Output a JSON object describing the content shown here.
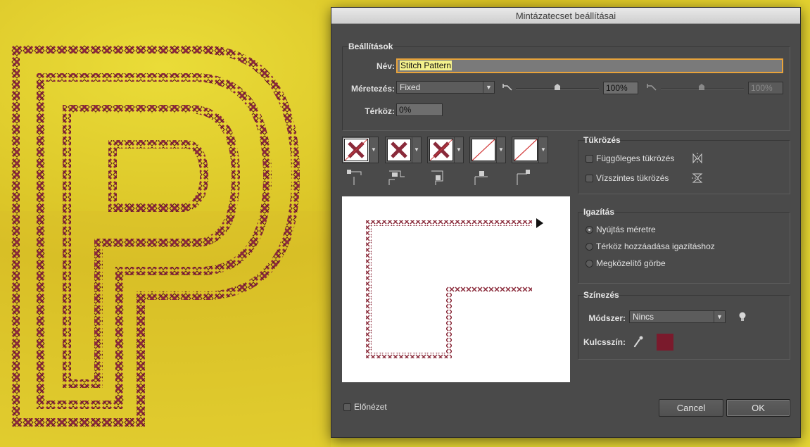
{
  "dialog": {
    "title": "Mintázatecset beállításai"
  },
  "settings": {
    "title": "Beállítások",
    "name_label": "Név:",
    "name_value": "Stitch Pattern",
    "scale_label": "Méretezés:",
    "scale_value": "Fixed",
    "scale_percent": "100%",
    "scale_percent_max": "100%",
    "spacing_label": "Térköz:",
    "spacing_value": "0%"
  },
  "tiles": [
    {
      "name": "side-tile",
      "selected": true
    },
    {
      "name": "outer-corner-tile"
    },
    {
      "name": "inner-corner-tile"
    },
    {
      "name": "start-tile"
    },
    {
      "name": "end-tile"
    }
  ],
  "flip": {
    "title": "Tükrözés",
    "vertical_label": "Függőleges tükrözés",
    "horizontal_label": "Vízszintes tükrözés",
    "vertical_checked": false,
    "horizontal_checked": false
  },
  "fit": {
    "title": "Igazítás",
    "options": [
      "Nyújtás méretre",
      "Térköz hozzáadása igazításhoz",
      "Megközelítő görbe"
    ],
    "selected_index": 0
  },
  "colorization": {
    "title": "Színezés",
    "method_label": "Módszer:",
    "method_value": "Nincs",
    "key_label": "Kulcsszín:",
    "key_color": "#7a1a2c"
  },
  "footer": {
    "preview_label": "Előnézet",
    "preview_checked": false,
    "cancel_label": "Cancel",
    "ok_label": "OK"
  },
  "colors": {
    "background_yellow": "#e0cc2a",
    "stitch": "#8a2a3a",
    "accent_focus": "#e8a33b"
  }
}
